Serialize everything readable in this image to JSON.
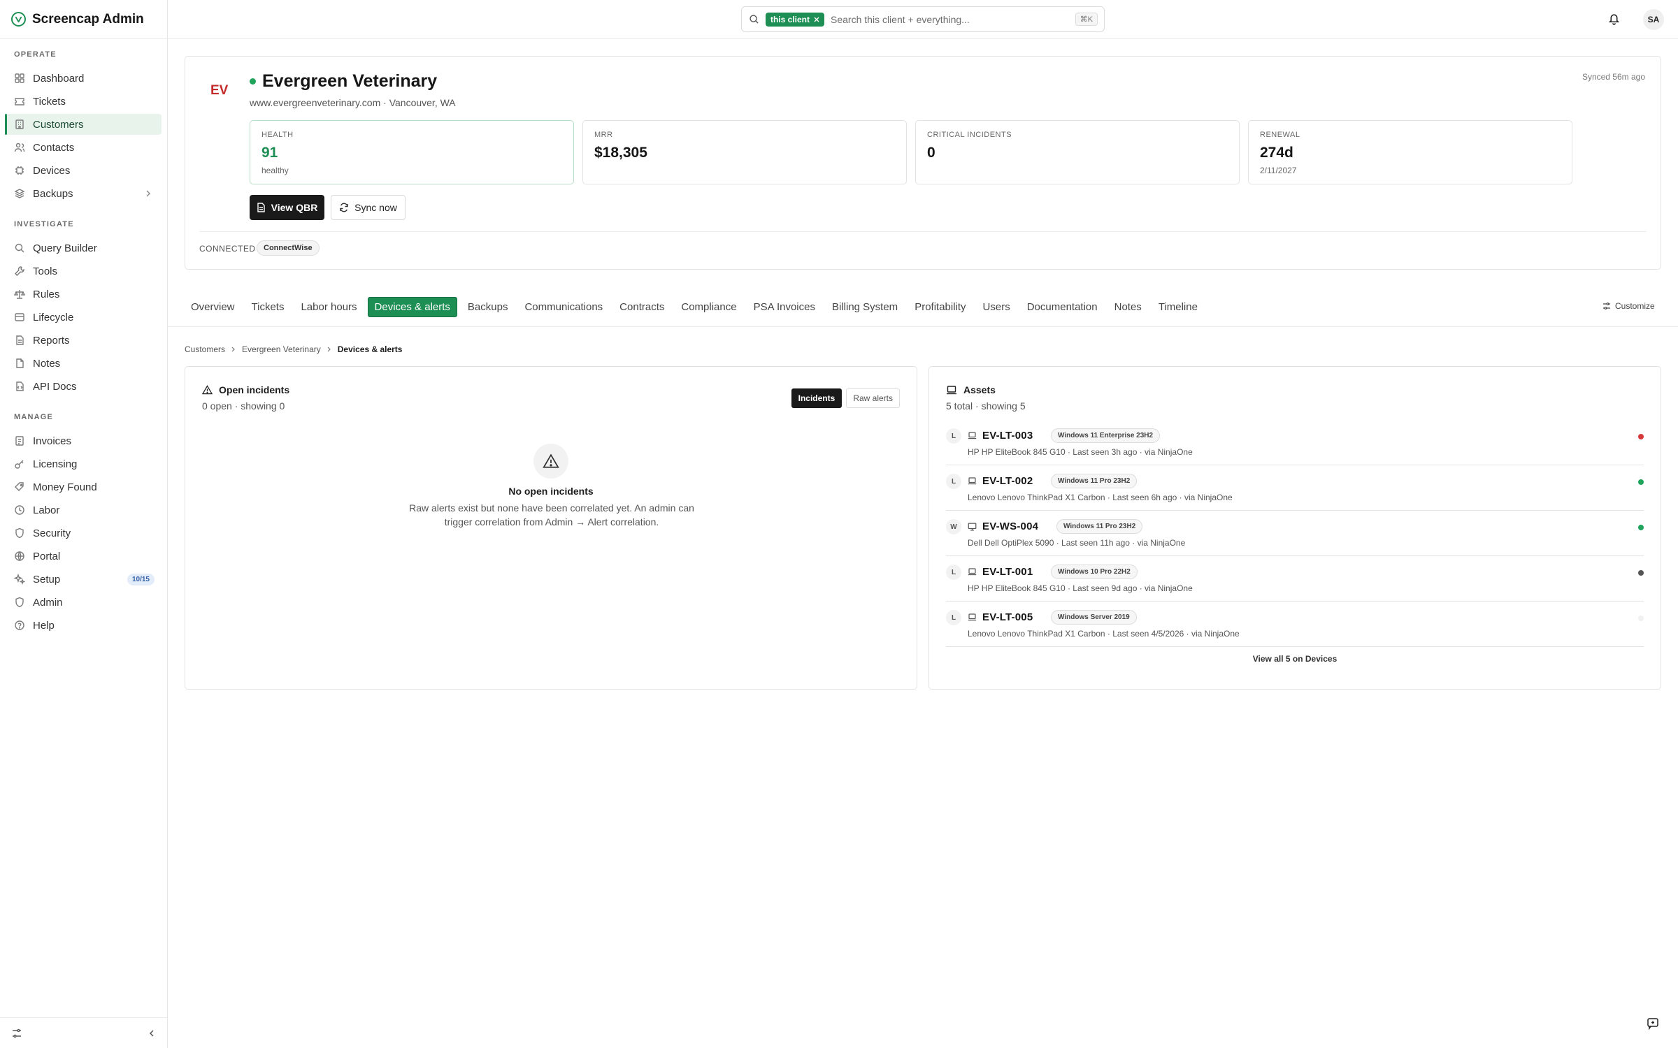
{
  "app": {
    "name": "Screencap Admin"
  },
  "sidebar": {
    "sections": [
      {
        "label": "OPERATE"
      },
      {
        "label": "INVESTIGATE"
      },
      {
        "label": "MANAGE"
      }
    ],
    "items": [
      {
        "label": "Dashboard",
        "icon": "dashboard-icon"
      },
      {
        "label": "Tickets",
        "icon": "ticket-icon"
      },
      {
        "label": "Customers",
        "icon": "building-icon",
        "active": true
      },
      {
        "label": "Contacts",
        "icon": "users-icon"
      },
      {
        "label": "Devices",
        "icon": "device-icon"
      },
      {
        "label": "Backups",
        "icon": "backup-icon"
      },
      {
        "label": "Query Builder",
        "icon": "search-icon"
      },
      {
        "label": "Tools",
        "icon": "wrench-icon"
      },
      {
        "label": "Rules",
        "icon": "scale-icon"
      },
      {
        "label": "Lifecycle",
        "icon": "lifecycle-icon"
      },
      {
        "label": "Reports",
        "icon": "report-icon"
      },
      {
        "label": "Notes",
        "icon": "note-icon"
      },
      {
        "label": "API Docs",
        "icon": "api-icon"
      },
      {
        "label": "Invoices",
        "icon": "invoice-icon"
      },
      {
        "label": "Licensing",
        "icon": "key-icon"
      },
      {
        "label": "Money Found",
        "icon": "money-icon"
      },
      {
        "label": "Labor",
        "icon": "clock-icon"
      },
      {
        "label": "Security",
        "icon": "shield-icon"
      },
      {
        "label": "Portal",
        "icon": "globe-icon"
      },
      {
        "label": "Setup",
        "icon": "sparkle-icon",
        "badge": "10/15"
      },
      {
        "label": "Admin",
        "icon": "admin-icon"
      },
      {
        "label": "Help",
        "icon": "help-icon"
      }
    ]
  },
  "search": {
    "scope_chip": "this client",
    "placeholder": "Search this client + everything...",
    "shortcut": "⌘K"
  },
  "user": {
    "initials": "SA"
  },
  "customer": {
    "initials": "EV",
    "name": "Evergreen Veterinary",
    "meta": "www.evergreenveterinary.com · Vancouver, WA",
    "synced": "Synced 56m ago",
    "status_color": "#20a35b",
    "stats": [
      {
        "label": "HEALTH",
        "value": "91",
        "sub": "healthy"
      },
      {
        "label": "MRR",
        "value": "$18,305",
        "sub": ""
      },
      {
        "label": "CRITICAL INCIDENTS",
        "value": "0",
        "sub": ""
      },
      {
        "label": "RENEWAL",
        "value": "274d",
        "sub": "2/11/2027"
      }
    ],
    "buttons": {
      "primary": "View QBR",
      "secondary": "Sync now"
    },
    "connected_label": "CONNECTED",
    "connected_value": "ConnectWise"
  },
  "tabs": [
    {
      "label": "Overview"
    },
    {
      "label": "Tickets"
    },
    {
      "label": "Labor hours"
    },
    {
      "label": "Devices & alerts",
      "active": true
    },
    {
      "label": "Backups"
    },
    {
      "label": "Communications"
    },
    {
      "label": "Contracts"
    },
    {
      "label": "Compliance"
    },
    {
      "label": "PSA Invoices"
    },
    {
      "label": "Billing System"
    },
    {
      "label": "Profitability"
    },
    {
      "label": "Users"
    },
    {
      "label": "Documentation"
    },
    {
      "label": "Notes"
    },
    {
      "label": "Timeline"
    }
  ],
  "customize_label": "Customize",
  "breadcrumb": [
    "Customers",
    "Evergreen Veterinary",
    "Devices & alerts"
  ],
  "incidents": {
    "title": "Open incidents",
    "subtitle": "0 open · showing 0",
    "toggle": [
      "Incidents",
      "Raw alerts"
    ],
    "empty_title": "No open incidents",
    "empty_text": "Raw alerts exist but none have been correlated yet. An admin can trigger correlation from Admin → Alert correlation."
  },
  "assets": {
    "title": "Assets",
    "subtitle": "5 total · showing 5",
    "items": [
      {
        "type": "L",
        "name": "EV-LT-003",
        "os": "Windows 11 Enterprise 23H2",
        "meta": "HP HP EliteBook 845 G10 · Last seen 3h ago · via NinjaOne",
        "status_color": "#d53a3a",
        "device": "laptop"
      },
      {
        "type": "L",
        "name": "EV-LT-002",
        "os": "Windows 11 Pro 23H2",
        "meta": "Lenovo Lenovo ThinkPad X1 Carbon · Last seen 6h ago · via NinjaOne",
        "status_color": "#20a35b",
        "device": "laptop"
      },
      {
        "type": "W",
        "name": "EV-WS-004",
        "os": "Windows 11 Pro 23H2",
        "meta": "Dell Dell OptiPlex 5090 · Last seen 11h ago · via NinjaOne",
        "status_color": "#20a35b",
        "device": "monitor"
      },
      {
        "type": "L",
        "name": "EV-LT-001",
        "os": "Windows 10 Pro 22H2",
        "meta": "HP HP EliteBook 845 G10 · Last seen 9d ago · via NinjaOne",
        "status_color": "#555555",
        "device": "laptop"
      },
      {
        "type": "L",
        "name": "EV-LT-005",
        "os": "Windows Server 2019",
        "meta": "Lenovo Lenovo ThinkPad X1 Carbon · Last seen 4/5/2026 · via NinjaOne",
        "status_color": "#f1f1f1",
        "device": "laptop"
      }
    ],
    "view_all": "View all 5 on Devices"
  }
}
